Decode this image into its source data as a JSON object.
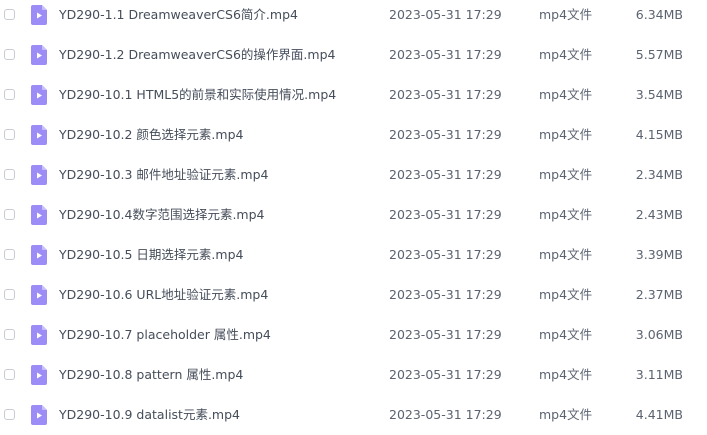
{
  "files": [
    {
      "name": "YD290-1.1 DreamweaverCS6简介.mp4",
      "date": "2023-05-31 17:29",
      "type": "mp4文件",
      "size": "6.34MB"
    },
    {
      "name": "YD290-1.2 DreamweaverCS6的操作界面.mp4",
      "date": "2023-05-31 17:29",
      "type": "mp4文件",
      "size": "5.57MB"
    },
    {
      "name": "YD290-10.1 HTML5的前景和实际使用情况.mp4",
      "date": "2023-05-31 17:29",
      "type": "mp4文件",
      "size": "3.54MB"
    },
    {
      "name": "YD290-10.2 颜色选择元素.mp4",
      "date": "2023-05-31 17:29",
      "type": "mp4文件",
      "size": "4.15MB"
    },
    {
      "name": "YD290-10.3 邮件地址验证元素.mp4",
      "date": "2023-05-31 17:29",
      "type": "mp4文件",
      "size": "2.34MB"
    },
    {
      "name": "YD290-10.4数字范围选择元素.mp4",
      "date": "2023-05-31 17:29",
      "type": "mp4文件",
      "size": "2.43MB"
    },
    {
      "name": "YD290-10.5 日期选择元素.mp4",
      "date": "2023-05-31 17:29",
      "type": "mp4文件",
      "size": "3.39MB"
    },
    {
      "name": "YD290-10.6 URL地址验证元素.mp4",
      "date": "2023-05-31 17:29",
      "type": "mp4文件",
      "size": "2.37MB"
    },
    {
      "name": "YD290-10.7 placeholder 属性.mp4",
      "date": "2023-05-31 17:29",
      "type": "mp4文件",
      "size": "3.06MB"
    },
    {
      "name": "YD290-10.8 pattern 属性.mp4",
      "date": "2023-05-31 17:29",
      "type": "mp4文件",
      "size": "3.11MB"
    },
    {
      "name": "YD290-10.9 datalist元素.mp4",
      "date": "2023-05-31 17:29",
      "type": "mp4文件",
      "size": "4.41MB"
    }
  ],
  "icon": {
    "name": "video-file-icon",
    "color": "#9c8cf6",
    "fold_color": "#c9bffb"
  }
}
